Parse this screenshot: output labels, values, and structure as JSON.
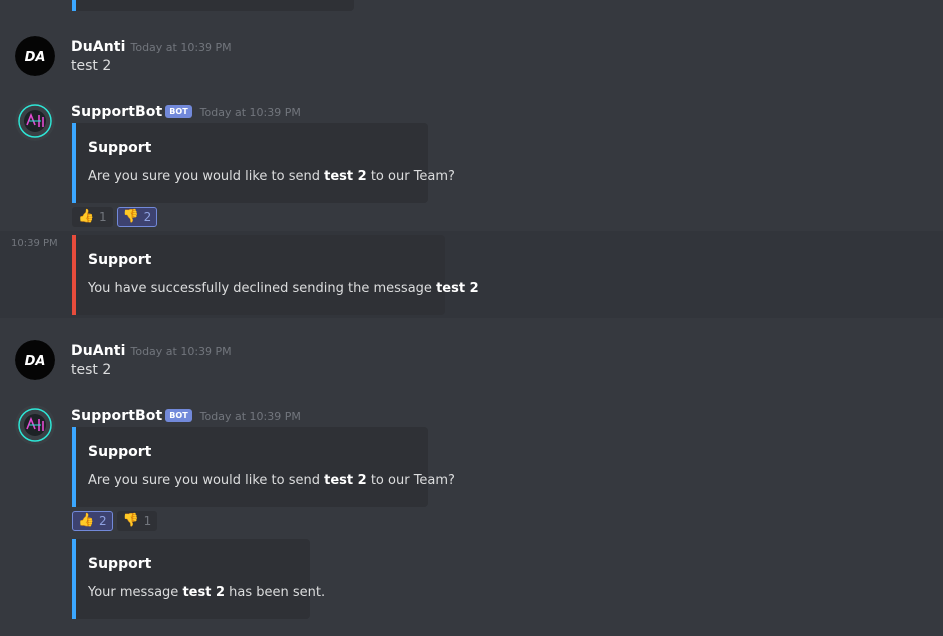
{
  "messages": [
    {
      "username": "DuAnti",
      "timestamp": "Today at 10:39 PM",
      "text": "test 2",
      "avatar_text": "DA"
    },
    {
      "username": "SupportBot",
      "bot_tag": "BOT",
      "timestamp": "Today at 10:39 PM",
      "embed": {
        "title": "Support",
        "desc_pre": "Are you sure you would like to send ",
        "desc_bold": "test 2",
        "desc_post": " to our Team?"
      },
      "reactions": [
        {
          "emoji": "👍",
          "count": "1",
          "active": false
        },
        {
          "emoji": "👎",
          "count": "2",
          "active": true
        }
      ]
    },
    {
      "side_time": "10:39 PM",
      "embed": {
        "title": "Support",
        "desc_pre": "You have successfully declined sending the message ",
        "desc_bold": "test 2",
        "desc_post": ""
      }
    },
    {
      "username": "DuAnti",
      "timestamp": "Today at 10:39 PM",
      "text": "test 2",
      "avatar_text": "DA"
    },
    {
      "username": "SupportBot",
      "bot_tag": "BOT",
      "timestamp": "Today at 10:39 PM",
      "embed": {
        "title": "Support",
        "desc_pre": "Are you sure you would like to send ",
        "desc_bold": "test 2",
        "desc_post": " to our Team?"
      },
      "reactions": [
        {
          "emoji": "👍",
          "count": "2",
          "active": true
        },
        {
          "emoji": "👎",
          "count": "1",
          "active": false
        }
      ],
      "embed2": {
        "title": "Support",
        "desc_pre": "Your message ",
        "desc_bold": "test 2",
        "desc_post": " has been sent."
      }
    }
  ],
  "colors": {
    "background": "#36393f",
    "embed_bg": "#2f3136",
    "blue_accent": "#3ba7ff",
    "red_accent": "#e74c3c",
    "bot_tag": "#7289da"
  }
}
